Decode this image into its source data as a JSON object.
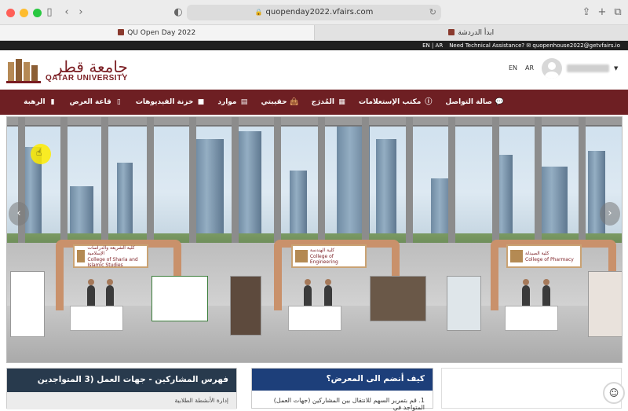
{
  "browser": {
    "url": "quopenday2022.vfairs.com",
    "tabs": [
      {
        "label": "QU Open Day 2022",
        "active": true
      },
      {
        "label": "ابدأ الدردشة",
        "active": false
      }
    ]
  },
  "top_strip": {
    "lang_switch": "EN | AR",
    "assistance": "Need Technical Assistance? ✉ quopenhouse2022@getvfairs.io"
  },
  "header": {
    "logo_ar": "جامعة قطر",
    "logo_en": "QATAR UNIVERSITY",
    "lang_en": "EN",
    "lang_ar": "AR"
  },
  "nav": [
    {
      "label": "صالة التواصل",
      "icon": "chat-icon"
    },
    {
      "label": "مكتب الإستعلامات",
      "icon": "info-icon"
    },
    {
      "label": "المُدرَج",
      "icon": "grid-icon"
    },
    {
      "label": "حقيبتي",
      "icon": "bag-icon"
    },
    {
      "label": "موارد",
      "icon": "document-icon"
    },
    {
      "label": "خزنة الفيديوهات",
      "icon": "video-icon"
    },
    {
      "label": "قاعة العرض",
      "icon": "booth-icon"
    },
    {
      "label": "الرهبة",
      "icon": "phone-icon"
    }
  ],
  "booths": [
    {
      "sign_ar": "كلية الشريعة والدراسات الإسلامية",
      "sign_en": "College of Sharia and Islamic Studies"
    },
    {
      "sign_ar": "كلية الهندسة",
      "sign_en": "College of Engineering"
    },
    {
      "sign_ar": "كلية الصيدلة",
      "sign_en": "College of Pharmacy"
    }
  ],
  "panels": {
    "left_card": {
      "title": "فهرس المشاركين - جهات العمل (3 المتواجدين",
      "row": "إدارة الأنشطة الطلابية"
    },
    "middle_card": {
      "title": "كيف أنضم الى المعرض؟",
      "row": "1. قم بتمرير السهم للانتقال بين المشاركين (جهات العمل) المتواجد في"
    }
  },
  "colors": {
    "brand_maroon": "#6e1f23",
    "card_navy": "#283a4d",
    "card_blue": "#1d3f7a",
    "cursor_highlight": "#ffec00"
  }
}
